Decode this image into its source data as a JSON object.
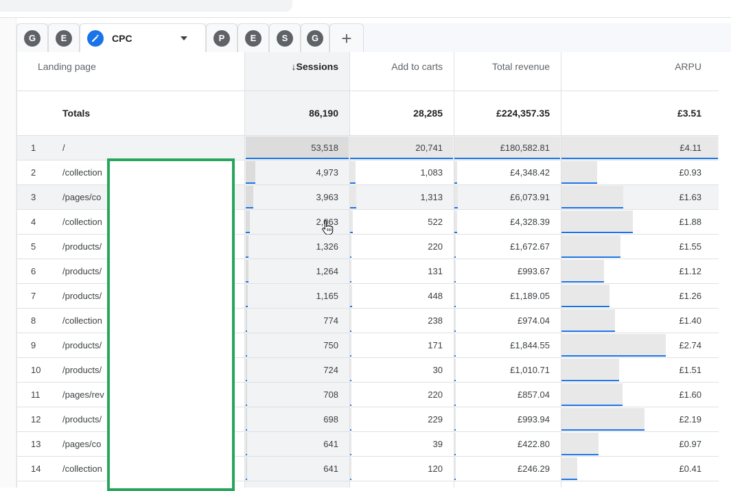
{
  "tabs": [
    {
      "letter": "G",
      "kind": "avatar"
    },
    {
      "letter": "E",
      "kind": "avatar"
    },
    {
      "label": "CPC",
      "kind": "active",
      "icon": "pencil-icon"
    },
    {
      "letter": "P",
      "kind": "avatar"
    },
    {
      "letter": "E",
      "kind": "avatar"
    },
    {
      "letter": "S",
      "kind": "avatar"
    },
    {
      "letter": "G",
      "kind": "avatar"
    },
    {
      "label": "+",
      "kind": "add"
    }
  ],
  "columns": {
    "landing_page": "Landing page",
    "sessions": "Sessions",
    "sessions_sort_icon": "↓",
    "add_to_carts": "Add to carts",
    "total_revenue": "Total revenue",
    "arpu": "ARPU"
  },
  "totals": {
    "label": "Totals",
    "sessions": "86,190",
    "add_to_carts": "28,285",
    "total_revenue": "£224,357.35",
    "arpu": "£3.51"
  },
  "rows": [
    {
      "rank": "1",
      "page": "/",
      "sessions": "53,518",
      "add_to_carts": "20,741",
      "total_revenue": "£180,582.81",
      "arpu": "£4.11"
    },
    {
      "rank": "2",
      "page": "/collection",
      "sessions": "4,973",
      "add_to_carts": "1,083",
      "total_revenue": "£4,348.42",
      "arpu": "£0.93"
    },
    {
      "rank": "3",
      "page": "/pages/co",
      "sessions": "3,963",
      "add_to_carts": "1,313",
      "total_revenue": "£6,073.91",
      "arpu": "£1.63"
    },
    {
      "rank": "4",
      "page": "/collection",
      "sessions": "2,063",
      "add_to_carts": "522",
      "total_revenue": "£4,328.39",
      "arpu": "£1.88"
    },
    {
      "rank": "5",
      "page": "/products/",
      "sessions": "1,326",
      "add_to_carts": "220",
      "total_revenue": "£1,672.67",
      "arpu": "£1.55"
    },
    {
      "rank": "6",
      "page": "/products/",
      "sessions": "1,264",
      "add_to_carts": "131",
      "total_revenue": "£993.67",
      "arpu": "£1.12"
    },
    {
      "rank": "7",
      "page": "/products/",
      "sessions": "1,165",
      "add_to_carts": "448",
      "total_revenue": "£1,189.05",
      "arpu": "£1.26"
    },
    {
      "rank": "8",
      "page": "/collection",
      "sessions": "774",
      "add_to_carts": "238",
      "total_revenue": "£974.04",
      "arpu": "£1.40"
    },
    {
      "rank": "9",
      "page": "/products/",
      "sessions": "750",
      "add_to_carts": "171",
      "total_revenue": "£1,844.55",
      "arpu": "£2.74"
    },
    {
      "rank": "10",
      "page": "/products/",
      "sessions": "724",
      "add_to_carts": "30",
      "total_revenue": "£1,010.71",
      "arpu": "£1.51"
    },
    {
      "rank": "11",
      "page": "/pages/rev",
      "sessions": "708",
      "add_to_carts": "220",
      "total_revenue": "£857.04",
      "arpu": "£1.60"
    },
    {
      "rank": "12",
      "page": "/products/",
      "sessions": "698",
      "add_to_carts": "229",
      "total_revenue": "£993.94",
      "arpu": "£2.19"
    },
    {
      "rank": "13",
      "page": "/pages/co",
      "sessions": "641",
      "add_to_carts": "39",
      "total_revenue": "£422.80",
      "arpu": "£0.97"
    },
    {
      "rank": "14",
      "page": "/collection",
      "sessions": "641",
      "add_to_carts": "120",
      "total_revenue": "£246.29",
      "arpu": "£0.41"
    }
  ],
  "colors": {
    "accent": "#1a73e8",
    "redaction_border": "#26a65b",
    "highlight_row": "#f1f3f4"
  }
}
